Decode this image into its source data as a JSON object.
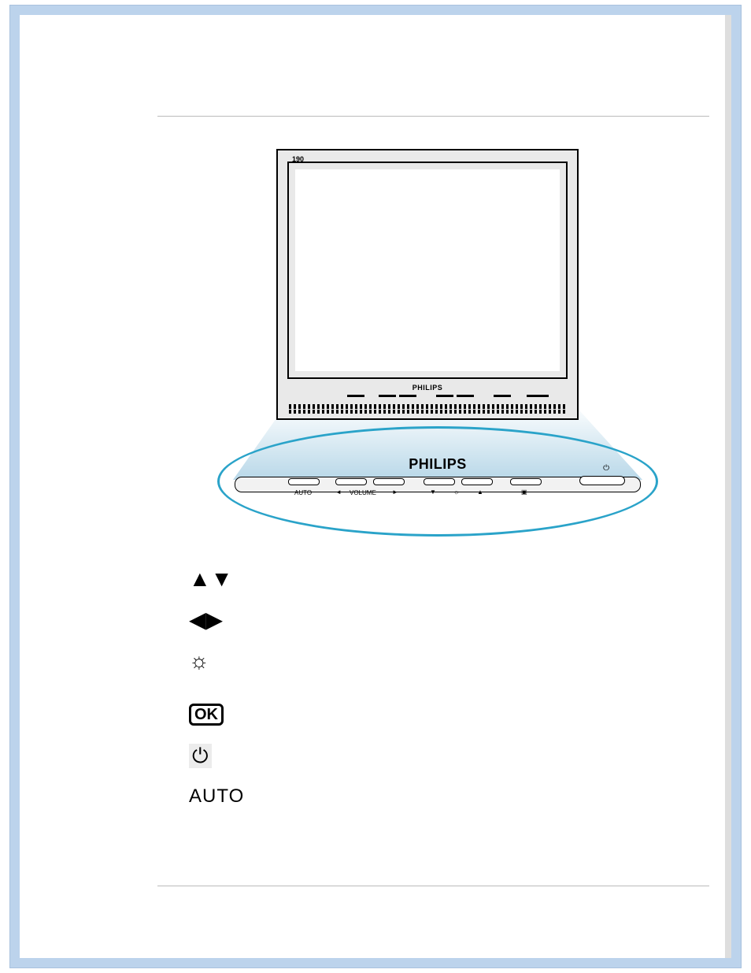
{
  "monitor": {
    "model_label": "190",
    "brand_small": "PHILIPS",
    "panel_labels": {
      "auto": "AUTO",
      "volume": "◄ VOLUME ►",
      "brightness": "▼  ☼  ▲",
      "ok": "▣"
    }
  },
  "zoom": {
    "brand": "PHILIPS",
    "labels": {
      "auto": "AUTO",
      "vol_left": "◄",
      "volume": "VOLUME",
      "vol_right": "►",
      "down": "▼",
      "bright": "☼",
      "up": "▲",
      "ok": "▣"
    },
    "power_symbol": "⏻"
  },
  "legend": {
    "updown": "▲▼",
    "leftright": "◀▶",
    "brightness": "☼",
    "ok": "OK",
    "power": "⏻",
    "auto": "AUTO"
  }
}
